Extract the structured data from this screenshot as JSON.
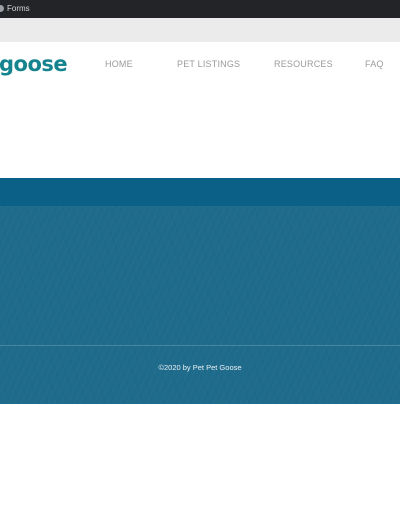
{
  "browser": {
    "tab_label": "Forms"
  },
  "header": {
    "logo": "goose",
    "nav": [
      {
        "label": "HOME"
      },
      {
        "label": "PET LISTINGS"
      },
      {
        "label": "RESOURCES"
      },
      {
        "label": "FAQ"
      }
    ]
  },
  "footer": {
    "copyright": "©2020 by Pet Pet Goose"
  },
  "colors": {
    "logo": "#16848e",
    "blue_band": "#0b6087",
    "footer_bg": "#1f6b8c",
    "nav_text": "#9a9a9a"
  }
}
